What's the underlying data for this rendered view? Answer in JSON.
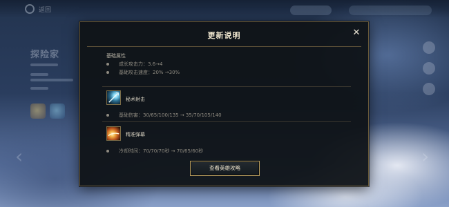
{
  "background": {
    "back_label": "返回",
    "hero_name": "探险家"
  },
  "modal": {
    "title": "更新说明",
    "close_symbol": "✕",
    "base_stats": {
      "label": "基础属性",
      "items": [
        "成长攻击力：3.6→4",
        "基础攻击速度：20% →30%"
      ]
    },
    "abilities": [
      {
        "name": "秘术射击",
        "icon": "mystic-shot-icon",
        "items": [
          "基础伤害：30/65/100/135 → 35/70/105/140"
        ]
      },
      {
        "name": "精准弹幕",
        "icon": "trueshot-barrage-icon",
        "items": [
          "冷却时间：70/70/70秒 → 70/65/60秒"
        ]
      }
    ],
    "guide_button": "查看英雄攻略"
  },
  "colors": {
    "modal_bg": "#0f1317",
    "modal_border": "#6a5b3a",
    "title_text": "#efe6cf",
    "muted_text": "#8f8b81",
    "button_border": "#b49a5c"
  }
}
